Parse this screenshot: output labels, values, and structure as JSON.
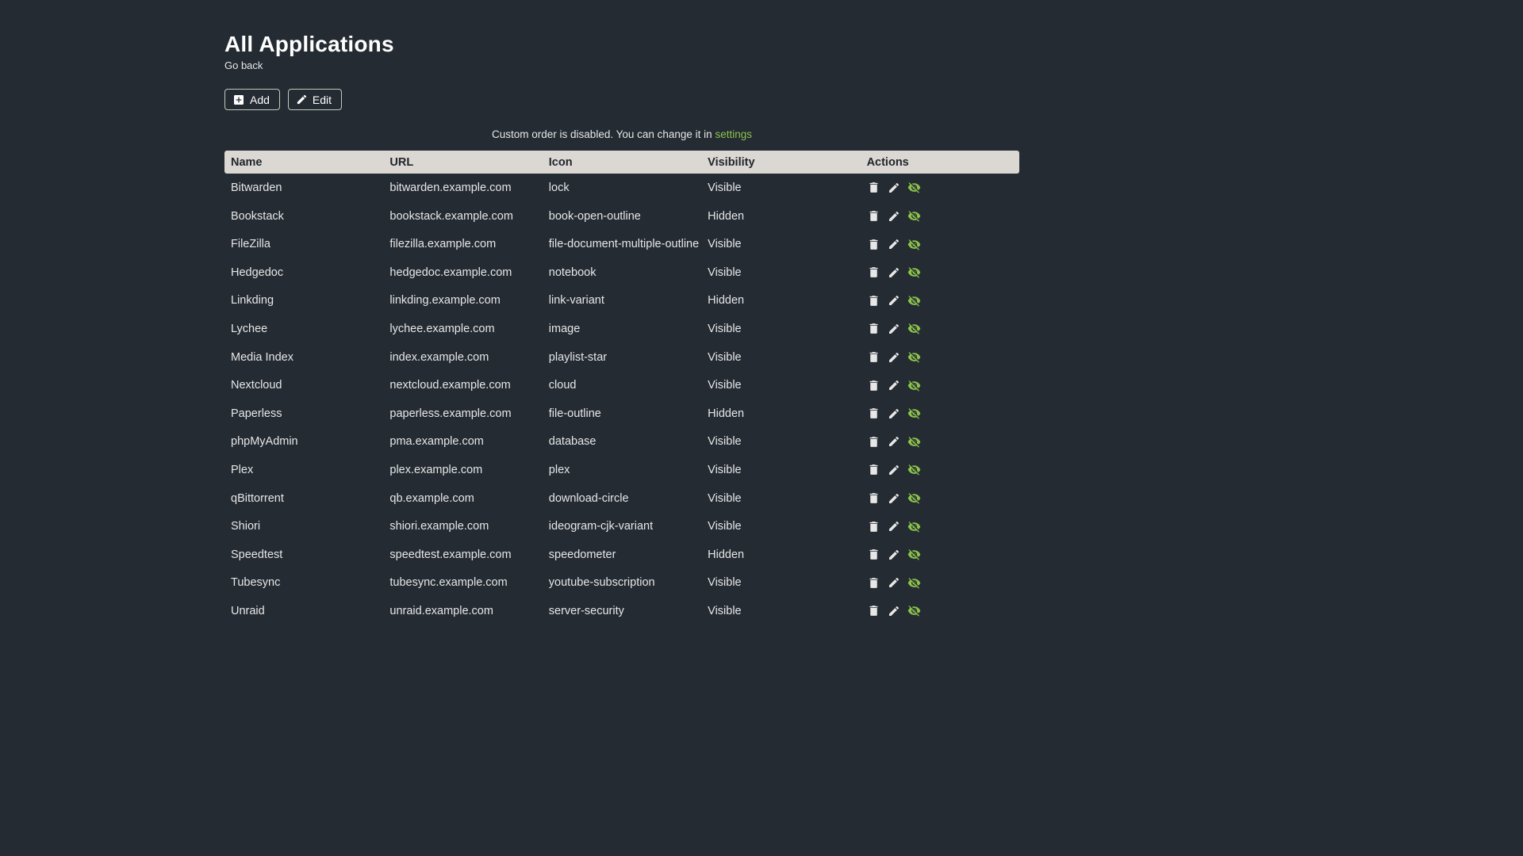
{
  "page": {
    "title": "All Applications",
    "back_link": "Go back",
    "add_button": "Add",
    "edit_button": "Edit",
    "notice_text": "Custom order is disabled. You can change it in ",
    "notice_link": "settings"
  },
  "colors": {
    "background": "#242b33",
    "accent_green": "#8bc34a",
    "table_header_bg": "#dbd8d3",
    "table_header_text": "#20252b",
    "row_text": "#e7e7e7"
  },
  "icons": {
    "add_button": "plus-box-icon",
    "edit_button": "pencil-icon",
    "row_actions": [
      "trash-icon",
      "pencil-icon",
      "eye-off-icon"
    ]
  },
  "table": {
    "headers": [
      "Name",
      "URL",
      "Icon",
      "Visibility",
      "Actions"
    ],
    "rows": [
      {
        "name": "Bitwarden",
        "url": "bitwarden.example.com",
        "icon": "lock",
        "visibility": "Visible"
      },
      {
        "name": "Bookstack",
        "url": "bookstack.example.com",
        "icon": "book-open-outline",
        "visibility": "Hidden"
      },
      {
        "name": "FileZilla",
        "url": "filezilla.example.com",
        "icon": "file-document-multiple-outline",
        "visibility": "Visible"
      },
      {
        "name": "Hedgedoc",
        "url": "hedgedoc.example.com",
        "icon": "notebook",
        "visibility": "Visible"
      },
      {
        "name": "Linkding",
        "url": "linkding.example.com",
        "icon": "link-variant",
        "visibility": "Hidden"
      },
      {
        "name": "Lychee",
        "url": "lychee.example.com",
        "icon": "image",
        "visibility": "Visible"
      },
      {
        "name": "Media Index",
        "url": "index.example.com",
        "icon": "playlist-star",
        "visibility": "Visible"
      },
      {
        "name": "Nextcloud",
        "url": "nextcloud.example.com",
        "icon": "cloud",
        "visibility": "Visible"
      },
      {
        "name": "Paperless",
        "url": "paperless.example.com",
        "icon": "file-outline",
        "visibility": "Hidden"
      },
      {
        "name": "phpMyAdmin",
        "url": "pma.example.com",
        "icon": "database",
        "visibility": "Visible"
      },
      {
        "name": "Plex",
        "url": "plex.example.com",
        "icon": "plex",
        "visibility": "Visible"
      },
      {
        "name": "qBittorrent",
        "url": "qb.example.com",
        "icon": "download-circle",
        "visibility": "Visible"
      },
      {
        "name": "Shiori",
        "url": "shiori.example.com",
        "icon": "ideogram-cjk-variant",
        "visibility": "Visible"
      },
      {
        "name": "Speedtest",
        "url": "speedtest.example.com",
        "icon": "speedometer",
        "visibility": "Hidden"
      },
      {
        "name": "Tubesync",
        "url": "tubesync.example.com",
        "icon": "youtube-subscription",
        "visibility": "Visible"
      },
      {
        "name": "Unraid",
        "url": "unraid.example.com",
        "icon": "server-security",
        "visibility": "Visible"
      }
    ]
  }
}
